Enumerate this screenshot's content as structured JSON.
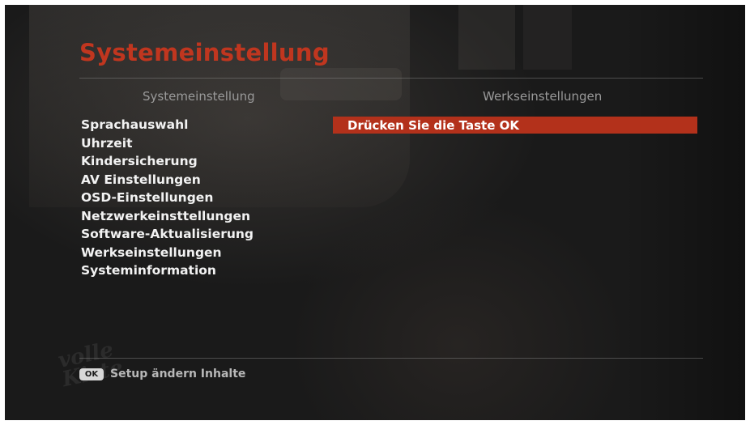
{
  "page_title": "Systemeinstellung",
  "left_column": {
    "heading": "Systemeinstellung",
    "items": [
      {
        "label": "Sprachauswahl"
      },
      {
        "label": "Uhrzeit"
      },
      {
        "label": "Kindersicherung"
      },
      {
        "label": "AV Einstellungen"
      },
      {
        "label": "OSD-Einstellungen"
      },
      {
        "label": "Netzwerkeinsttellungen"
      },
      {
        "label": "Software-Aktualisierung"
      },
      {
        "label": "Werkseinstellungen"
      },
      {
        "label": "Systeminformation"
      }
    ]
  },
  "right_column": {
    "heading": "Werkseinstellungen",
    "selected_item": "Drücken Sie die Taste OK"
  },
  "footer": {
    "key_label": "OK",
    "hint": "Setup ändern Inhalte"
  },
  "watermark_text": "volle Kiste",
  "colors": {
    "accent": "#c0361f",
    "highlight_bar": "#b3311b",
    "background": "#1a1a1a"
  }
}
